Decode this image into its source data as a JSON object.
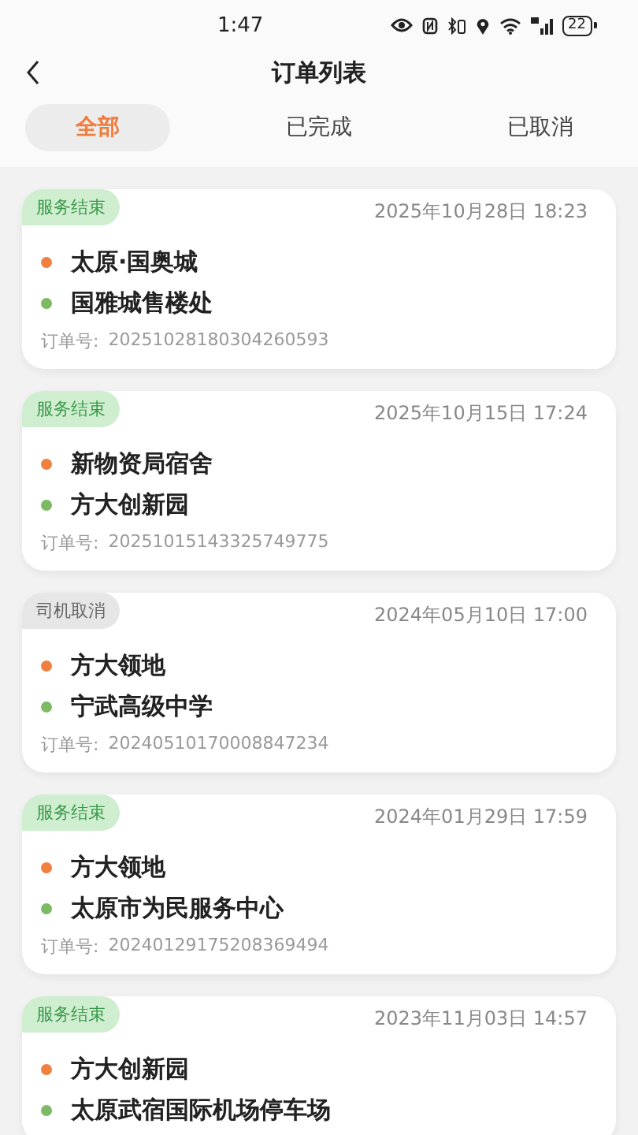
{
  "status_bar": {
    "time": "1:47",
    "battery": "22"
  },
  "header": {
    "title": "订单列表"
  },
  "tabs": [
    {
      "label": "全部",
      "selected": true
    },
    {
      "label": "已完成",
      "selected": false
    },
    {
      "label": "已取消",
      "selected": false
    }
  ],
  "orders": [
    {
      "status": "服务结束",
      "kind": "finished",
      "time": "2025年10月28日 18:23",
      "from": "太原·国奥城",
      "to": "国雅城售楼处",
      "order_no_label": "订单号:",
      "order_no": "20251028180304260593"
    },
    {
      "status": "服务结束",
      "kind": "finished",
      "time": "2025年10月15日 17:24",
      "from": "新物资局宿舍",
      "to": "方大创新园",
      "order_no_label": "订单号:",
      "order_no": "20251015143325749775"
    },
    {
      "status": "司机取消",
      "kind": "cancelled",
      "time": "2024年05月10日 17:00",
      "from": "方大领地",
      "to": "宁武高级中学",
      "order_no_label": "订单号:",
      "order_no": "20240510170008847234"
    },
    {
      "status": "服务结束",
      "kind": "finished",
      "time": "2024年01月29日 17:59",
      "from": "方大领地",
      "to": "太原市为民服务中心",
      "order_no_label": "订单号:",
      "order_no": "20240129175208369494"
    },
    {
      "status": "服务结束",
      "kind": "finished",
      "time": "2023年11月03日 14:57",
      "from": "方大创新园",
      "to": "太原武宿国际机场停车场"
    }
  ]
}
